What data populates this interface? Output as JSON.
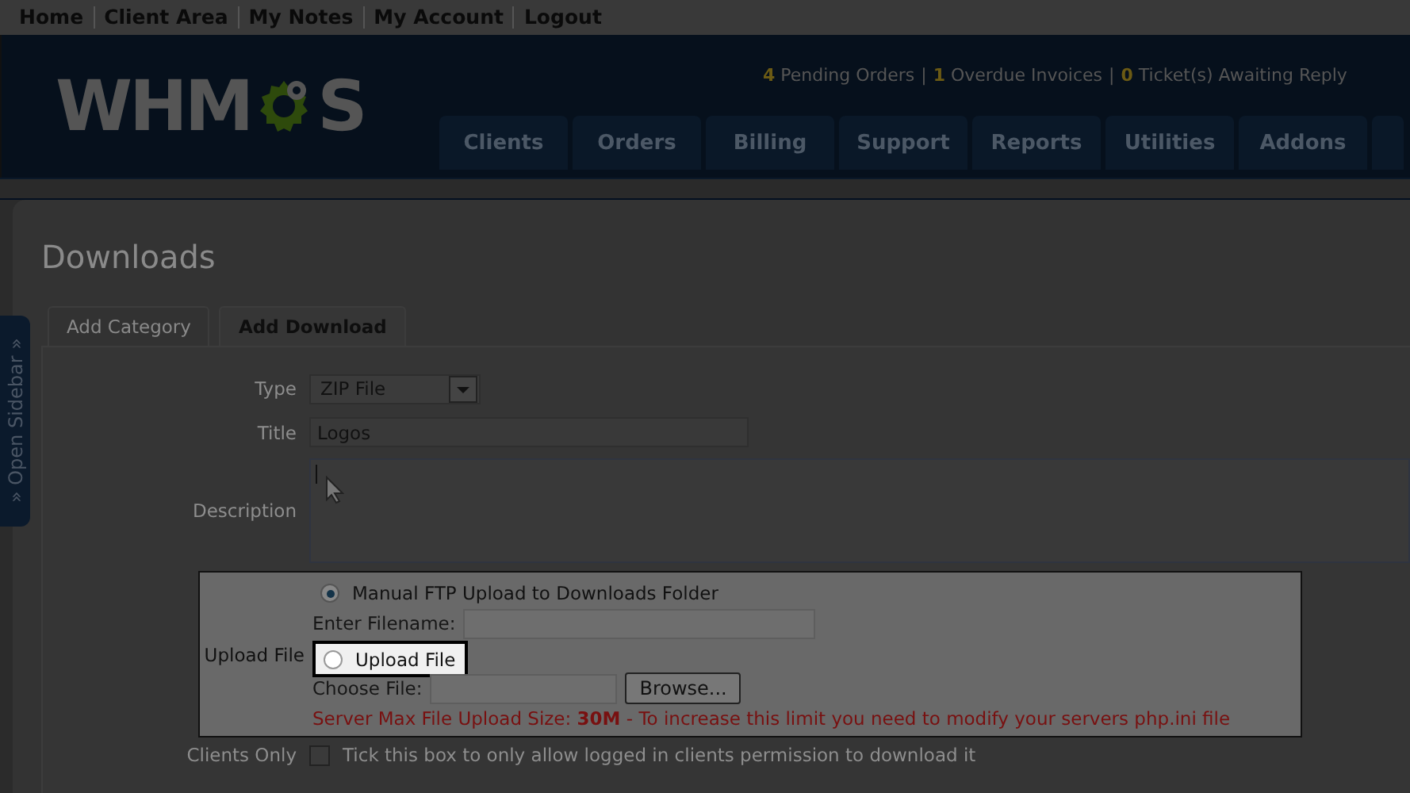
{
  "top_nav": [
    {
      "label": "Home"
    },
    {
      "label": "Client Area"
    },
    {
      "label": "My Notes"
    },
    {
      "label": "My Account"
    },
    {
      "label": "Logout"
    }
  ],
  "logo": {
    "left": "WHM",
    "right": "S"
  },
  "alerts": {
    "separator": "|",
    "items": [
      {
        "count": "4",
        "label": "Pending Orders"
      },
      {
        "count": "1",
        "label": "Overdue Invoices"
      },
      {
        "count": "0",
        "label": "Ticket(s) Awaiting Reply"
      }
    ]
  },
  "main_tabs": [
    {
      "label": "Clients"
    },
    {
      "label": "Orders"
    },
    {
      "label": "Billing"
    },
    {
      "label": "Support"
    },
    {
      "label": "Reports"
    },
    {
      "label": "Utilities"
    },
    {
      "label": "Addons"
    }
  ],
  "sidebar_toggle": "» Open Sidebar »",
  "page_title": "Downloads",
  "tabs": [
    {
      "label": "Add Category",
      "selected": false
    },
    {
      "label": "Add Download",
      "selected": true
    }
  ],
  "form": {
    "type": {
      "label": "Type",
      "value": "ZIP File"
    },
    "title": {
      "label": "Title",
      "value": "Logos"
    },
    "description": {
      "label": "Description"
    },
    "upload": {
      "label": "Upload File",
      "options": [
        {
          "label": "Manual FTP Upload to Downloads Folder",
          "selected": true,
          "highlighted": false
        },
        {
          "label": "Upload File",
          "selected": false,
          "highlighted": true
        }
      ],
      "filename_label": "Enter Filename:",
      "choose_label": "Choose File:",
      "browse": "Browse...",
      "note": "Server Max File Upload Size: **30M** - To increase this limit you need to modify your servers php.ini file"
    },
    "clients_only": {
      "label": "Clients Only",
      "checked": false,
      "text": "Tick this box to only allow logged in clients permission to download it"
    }
  }
}
